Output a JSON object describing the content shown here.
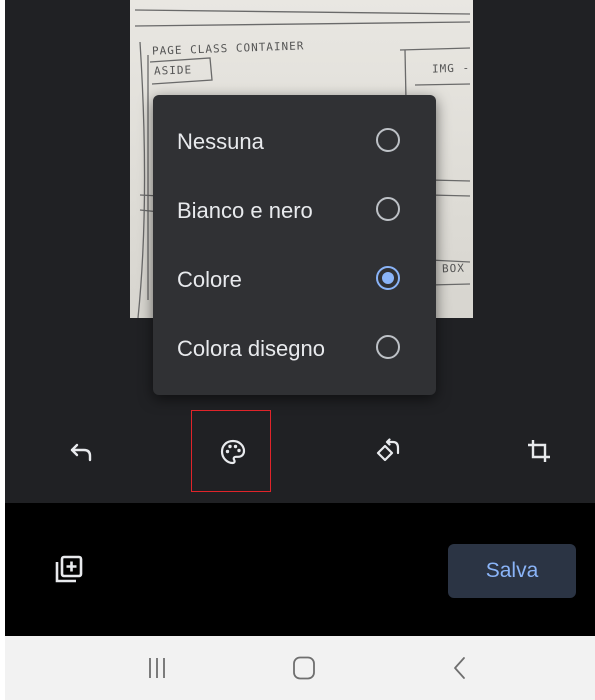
{
  "filter_menu": {
    "options": [
      {
        "label": "Nessuna",
        "selected": false
      },
      {
        "label": "Bianco e nero",
        "selected": false
      },
      {
        "label": "Colore",
        "selected": true
      },
      {
        "label": "Colora disegno",
        "selected": false
      }
    ]
  },
  "photo": {
    "handwriting": [
      "PAGE CLASS CONTAINER",
      "ASIDE",
      "IMG -",
      "BOX"
    ]
  },
  "toolbar": {
    "tools": [
      {
        "icon": "undo-icon"
      },
      {
        "icon": "palette-icon",
        "highlighted": true
      },
      {
        "icon": "rotate-icon"
      },
      {
        "icon": "crop-icon"
      }
    ]
  },
  "bottom_bar": {
    "add_page_icon": "add-page-icon",
    "save_label": "Salva"
  },
  "nav_bar": {
    "buttons": [
      {
        "icon": "recent-apps-icon"
      },
      {
        "icon": "home-icon"
      },
      {
        "icon": "back-icon"
      }
    ]
  },
  "colors": {
    "editor_background": "#202124",
    "menu_background": "#303134",
    "accent": "#8ab4f8",
    "highlight_border": "#e0242a",
    "save_button_background": "#2b3444",
    "nav_background": "#f2f2f2"
  }
}
